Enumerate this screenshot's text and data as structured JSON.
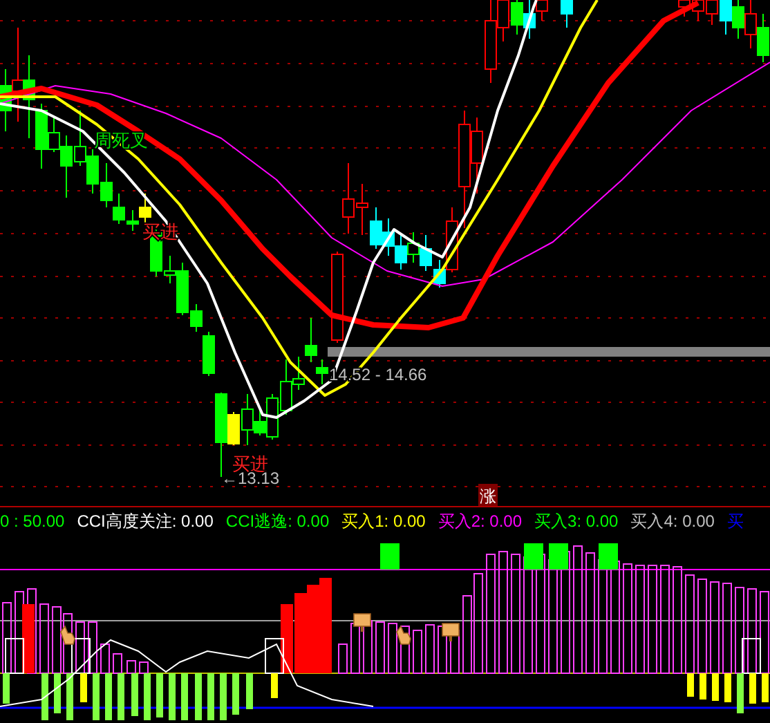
{
  "chart": {
    "annotations": [
      {
        "text": "周死叉",
        "kind": "cross"
      },
      {
        "text": "买进",
        "kind": "signal"
      },
      {
        "text": "14.52 - 14.66",
        "kind": "price"
      },
      {
        "text": "买进",
        "kind": "signal"
      },
      {
        "text": "←13.13",
        "kind": "price"
      }
    ],
    "badge": "涨"
  },
  "legend": [
    {
      "text": "0 : 50.00",
      "color": "#00ff00"
    },
    {
      "text": "CCI高度关注: 0.00",
      "color": "#ffffff"
    },
    {
      "text": "CCI逃逸: 0.00",
      "color": "#00ff00"
    },
    {
      "text": "买入1: 0.00",
      "color": "#ffff00"
    },
    {
      "text": "买入2: 0.00",
      "color": "#ff00ff"
    },
    {
      "text": "买入3: 0.00",
      "color": "#00ff00"
    },
    {
      "text": "买入4: 0.00",
      "color": "#c0c0c0"
    },
    {
      "text": "买",
      "color": "#0000ff"
    }
  ]
}
